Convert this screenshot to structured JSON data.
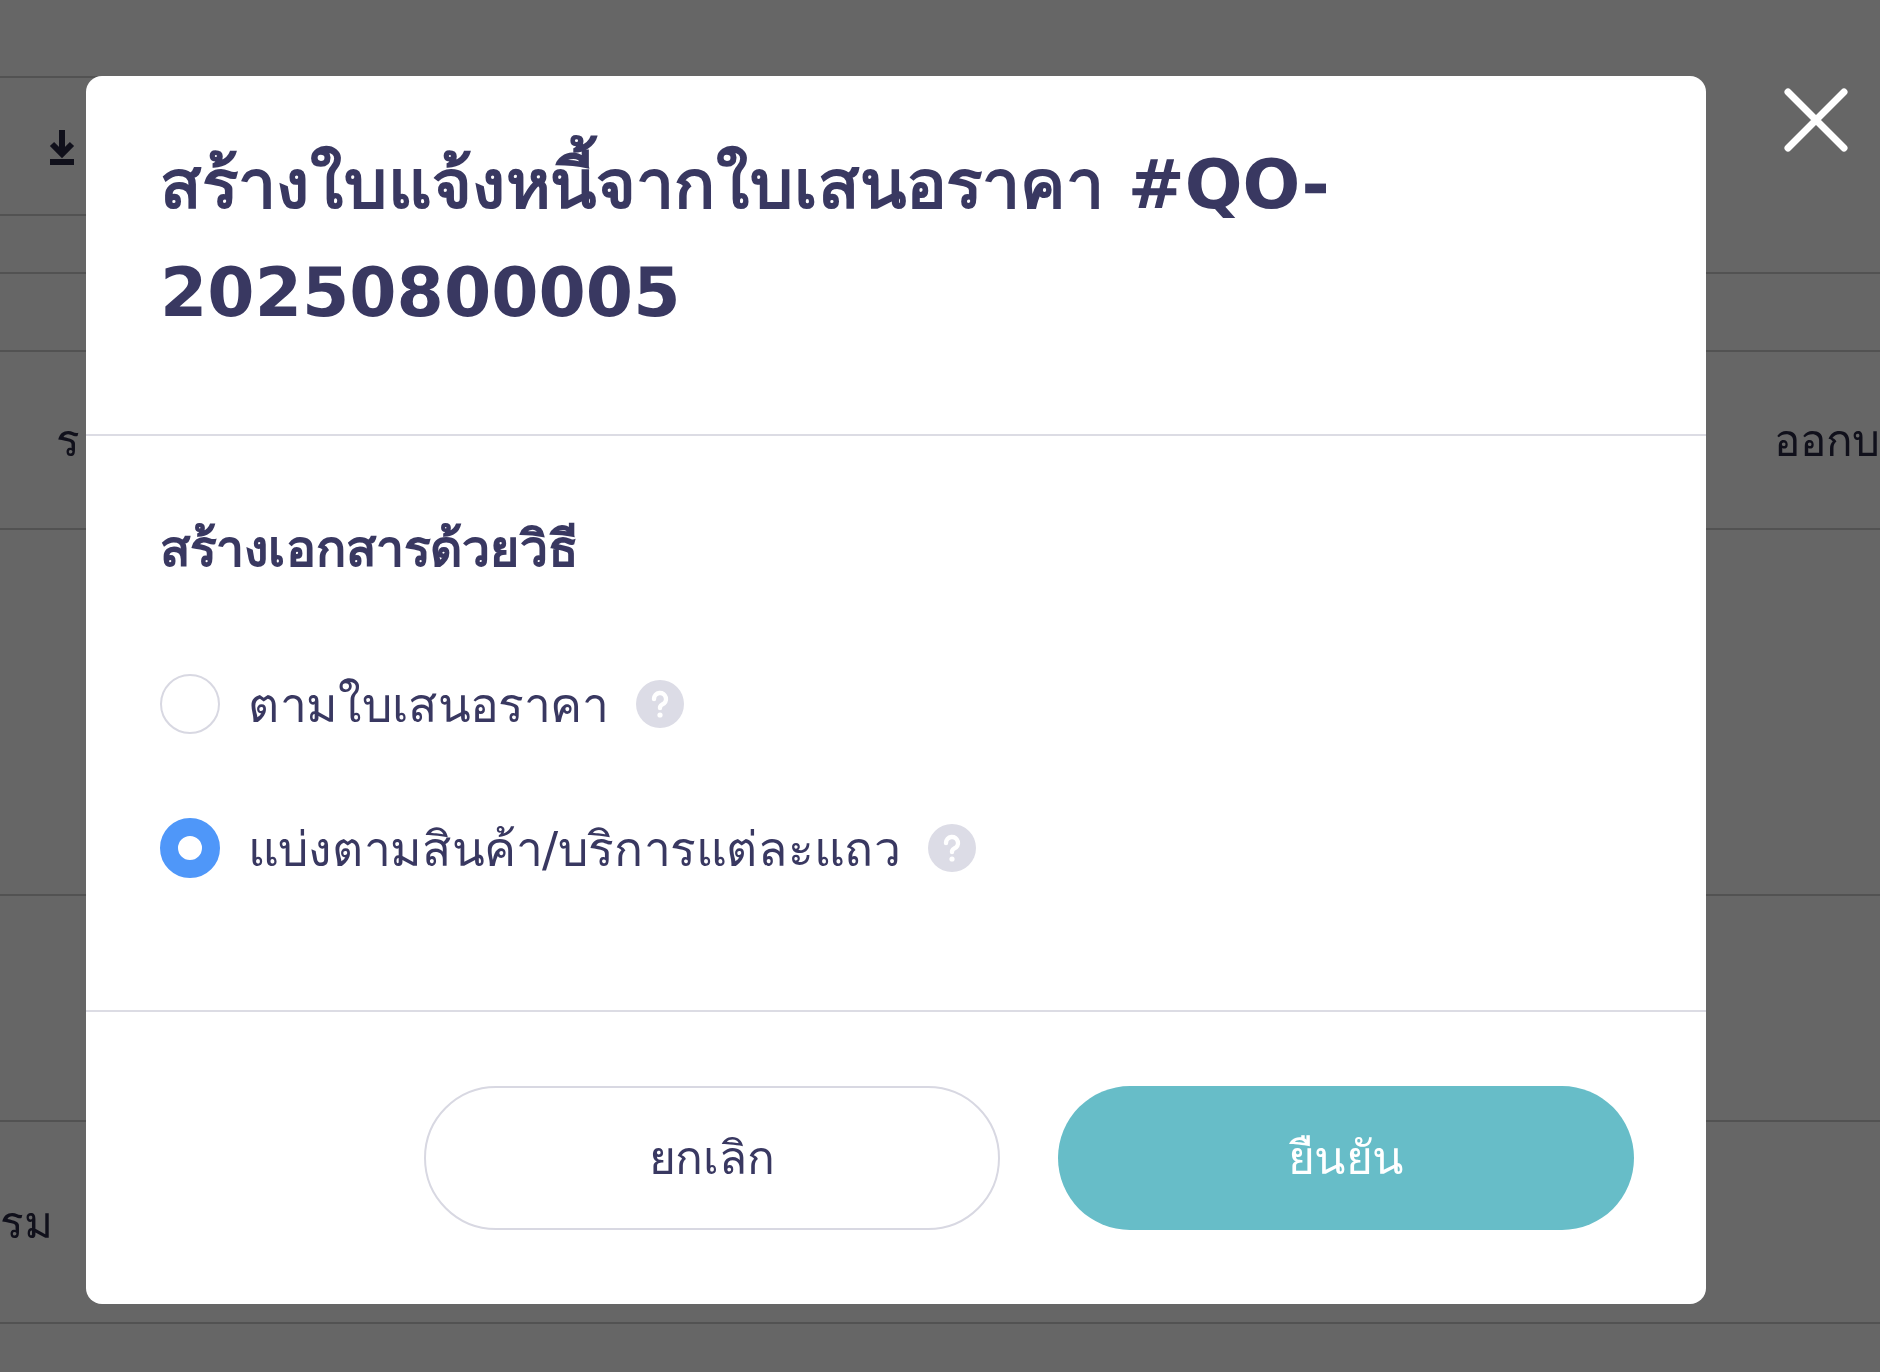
{
  "background": {
    "row_left_text": "ร",
    "row_right_text": "ออกบ",
    "bottom_left_text": "รม"
  },
  "dialog": {
    "title": "สร้างใบแจ้งหนี้จากใบเสนอราคา #QO-20250800005",
    "section_label": "สร้างเอกสารด้วยวิธี",
    "options": [
      {
        "label": "ตามใบเสนอราคา",
        "selected": false
      },
      {
        "label": "แบ่งตามสินค้า/บริการแต่ละแถว",
        "selected": true
      }
    ],
    "buttons": [
      {
        "kind": "secondary",
        "label": "ยกเลิก"
      },
      {
        "kind": "primary",
        "label": "ยืนยัน"
      }
    ]
  }
}
